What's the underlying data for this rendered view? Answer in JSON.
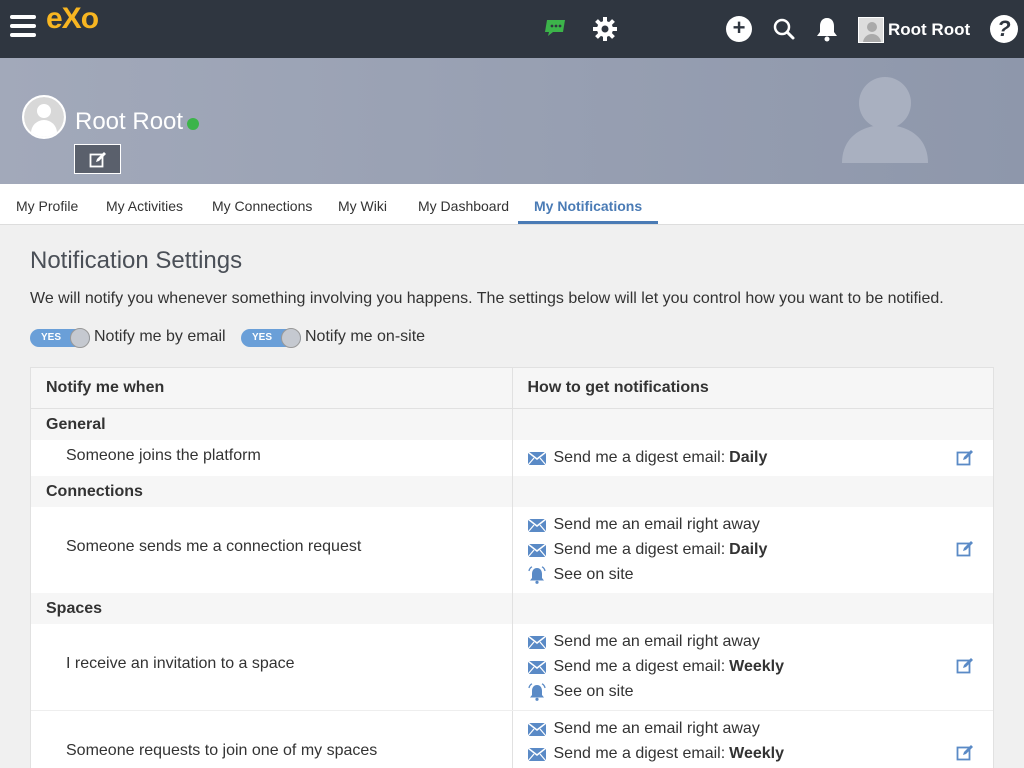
{
  "header": {
    "logo": "eXo",
    "user_name": "Root Root",
    "plus_label": "+",
    "help_label": "?"
  },
  "profile": {
    "display_name": "Root Root",
    "status_color": "#3cb44a"
  },
  "tabs": [
    {
      "label": "My Profile"
    },
    {
      "label": "My Activities"
    },
    {
      "label": "My Connections"
    },
    {
      "label": "My Wiki"
    },
    {
      "label": "My Dashboard"
    },
    {
      "label": "My Notifications",
      "active": true
    }
  ],
  "settings": {
    "title": "Notification Settings",
    "description": "We will notify you whenever something involving you happens. The settings below will let you control how you want to be notified.",
    "email_toggle": {
      "state": "YES",
      "label": "Notify me by email"
    },
    "site_toggle": {
      "state": "YES",
      "label": "Notify me on-site"
    }
  },
  "table": {
    "col_left": "Notify me when",
    "col_right": "How to get notifications",
    "groups": [
      {
        "name": "General",
        "items": [
          {
            "label": "Someone joins the platform",
            "methods": [
              {
                "icon": "envelope-icon",
                "text": "Send me a digest email:",
                "freq": "Daily"
              }
            ]
          }
        ]
      },
      {
        "name": "Connections",
        "items": [
          {
            "label": "Someone sends me a connection request",
            "methods": [
              {
                "icon": "envelope-icon",
                "text": "Send me an email right away",
                "freq": ""
              },
              {
                "icon": "envelope-icon",
                "text": "Send me a digest email:",
                "freq": "Daily"
              },
              {
                "icon": "bell-icon",
                "text": "See on site",
                "freq": ""
              }
            ]
          }
        ]
      },
      {
        "name": "Spaces",
        "items": [
          {
            "label": "I receive an invitation to a space",
            "methods": [
              {
                "icon": "envelope-icon",
                "text": "Send me an email right away",
                "freq": ""
              },
              {
                "icon": "envelope-icon",
                "text": "Send me a digest email:",
                "freq": "Weekly"
              },
              {
                "icon": "bell-icon",
                "text": "See on site",
                "freq": ""
              }
            ]
          },
          {
            "label": "Someone requests to join one of my spaces",
            "methods": [
              {
                "icon": "envelope-icon",
                "text": "Send me an email right away",
                "freq": ""
              },
              {
                "icon": "envelope-icon",
                "text": "Send me a digest email:",
                "freq": "Weekly"
              }
            ]
          }
        ]
      }
    ]
  }
}
